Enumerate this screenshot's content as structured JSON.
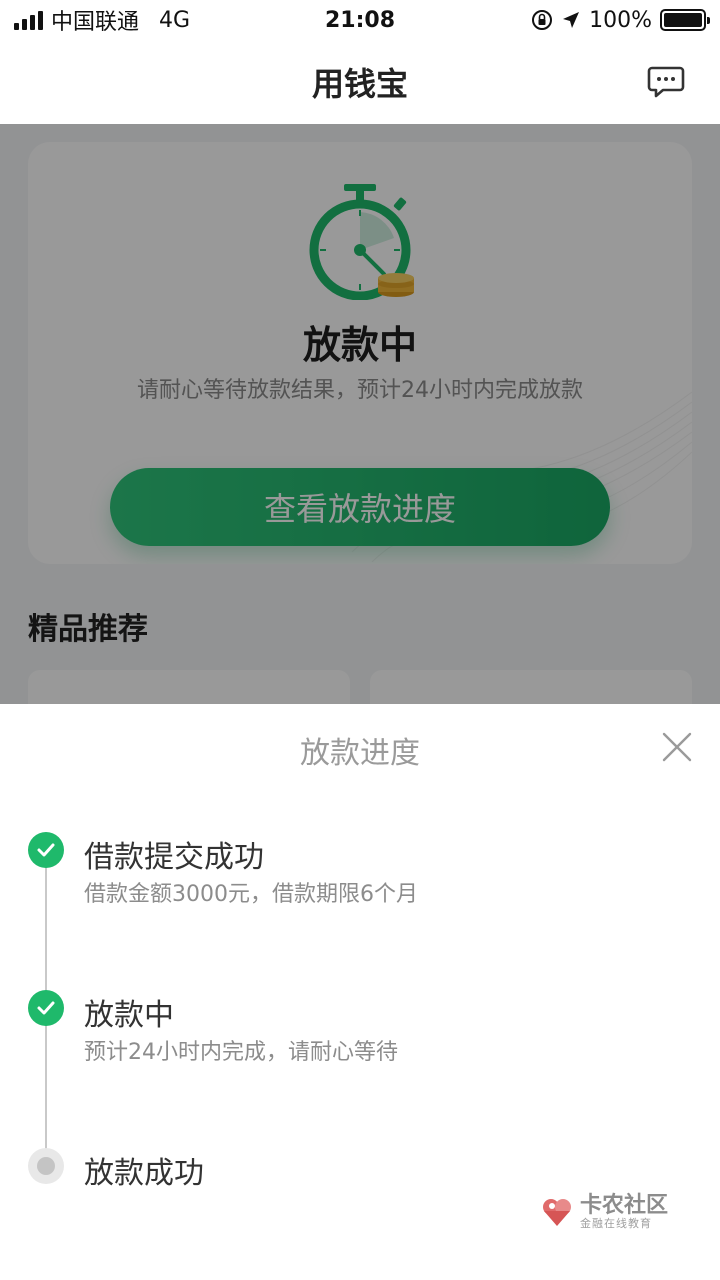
{
  "status_bar": {
    "carrier": "中国联通",
    "network": "4G",
    "time": "21:08",
    "battery_pct": "100%"
  },
  "nav": {
    "title": "用钱宝",
    "message_icon": "chat-bubble-icon"
  },
  "status_card": {
    "icon": "stopwatch-coins-icon",
    "title": "放款中",
    "description": "请耐心等待放款结果，预计24小时内完成放款",
    "button_label": "查看放款进度"
  },
  "recommend": {
    "title": "精品推荐"
  },
  "sheet": {
    "title": "放款进度",
    "close_icon": "close-icon",
    "steps": [
      {
        "title": "借款提交成功",
        "desc": "借款金额3000元，借款期限6个月",
        "state": "done"
      },
      {
        "title": "放款中",
        "desc": "预计24小时内完成，请耐心等待",
        "state": "done"
      },
      {
        "title": "放款成功",
        "desc": "",
        "state": "pending"
      }
    ]
  },
  "watermark": {
    "main": "卡农社区",
    "sub": "金融在线教育"
  },
  "colors": {
    "accent_green": "#1fb96b",
    "overlay": "rgba(0,0,0,0.4)"
  }
}
